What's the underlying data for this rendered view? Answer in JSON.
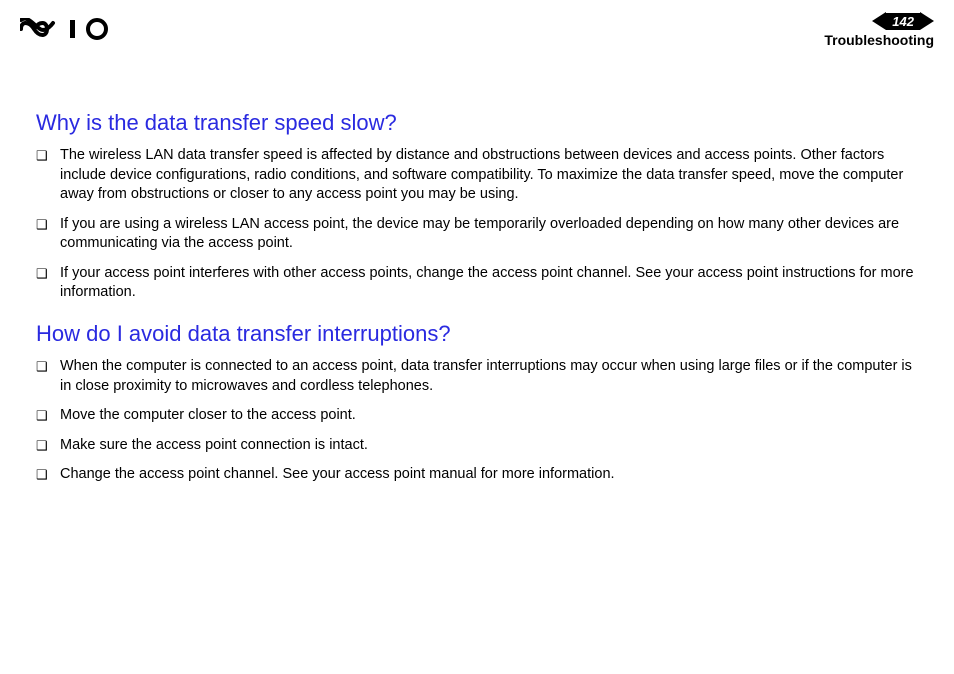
{
  "header": {
    "page_number": "142",
    "section": "Troubleshooting"
  },
  "sections": [
    {
      "heading": "Why is the data transfer speed slow?",
      "items": [
        "The wireless LAN data transfer speed is affected by distance and obstructions between devices and access points. Other factors include device configurations, radio conditions, and software compatibility. To maximize the data transfer speed, move the computer away from obstructions or closer to any access point you may be using.",
        "If you are using a wireless LAN access point, the device may be temporarily overloaded depending on how many other devices are communicating via the access point.",
        "If your access point interferes with other access points, change the access point channel. See your access point instructions for more information."
      ]
    },
    {
      "heading": "How do I avoid data transfer interruptions?",
      "items": [
        "When the computer is connected to an access point, data transfer interruptions may occur when using large files or if the computer is in close proximity to microwaves and cordless telephones.",
        "Move the computer closer to the access point.",
        "Make sure the access point connection is intact.",
        "Change the access point channel. See your access point manual for more information."
      ]
    }
  ]
}
